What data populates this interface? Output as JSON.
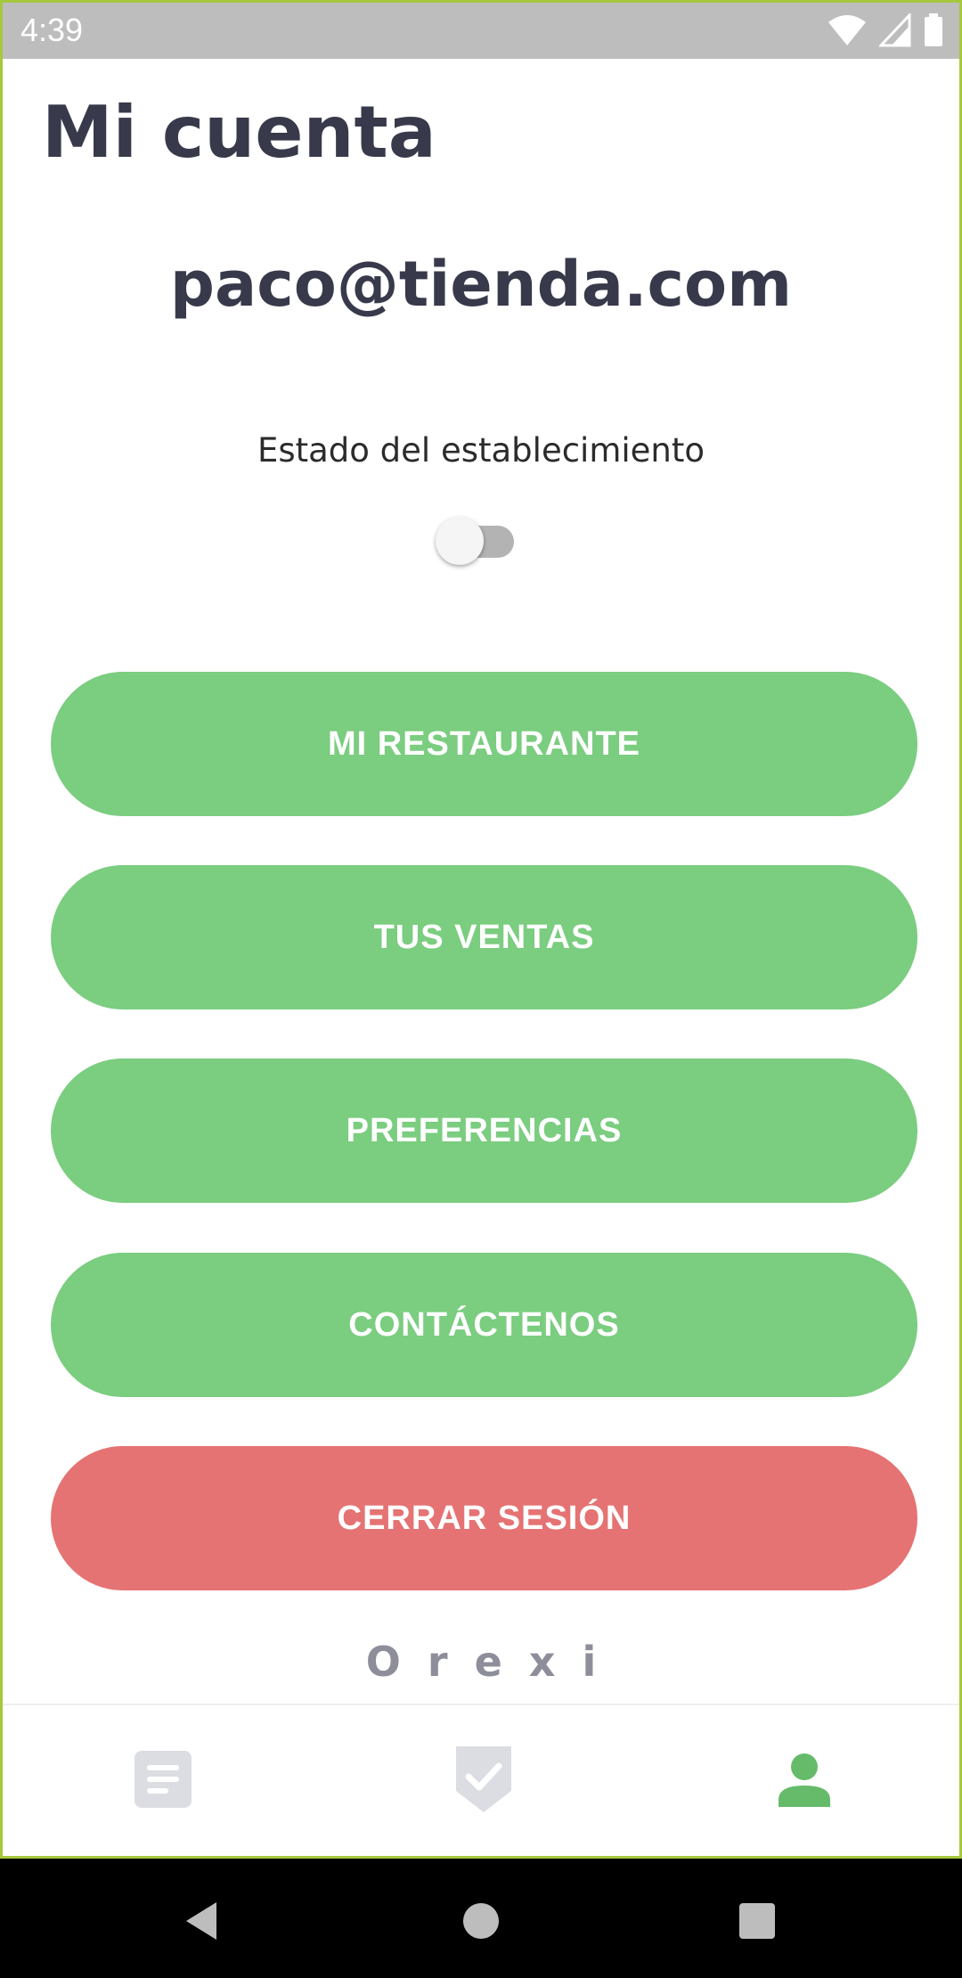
{
  "status_bar": {
    "time": "4:39",
    "icons": [
      "wifi-icon",
      "signal-icon",
      "battery-icon"
    ]
  },
  "header": {
    "title": "Mi cuenta"
  },
  "account": {
    "email": "paco@tienda.com"
  },
  "estado": {
    "label": "Estado del establecimiento",
    "toggle_on": false
  },
  "buttons": [
    {
      "label": "MI RESTAURANTE"
    },
    {
      "label": "TUS VENTAS"
    },
    {
      "label": "PREFERENCIAS"
    },
    {
      "label": "CONTÁCTENOS"
    },
    {
      "label": "CERRAR SESIÓN"
    }
  ],
  "brand": "Orexi",
  "bottom_nav": [
    {
      "icon": "document-icon",
      "active": false
    },
    {
      "icon": "badge-check-icon",
      "active": false
    },
    {
      "icon": "person-icon",
      "active": true
    }
  ],
  "colors": {
    "primary_green": "#7bcd80",
    "danger_red": "#e57373",
    "title_text": "#383a4b",
    "inactive_icon": "#dcdde3",
    "active_icon": "#66bb6a"
  }
}
